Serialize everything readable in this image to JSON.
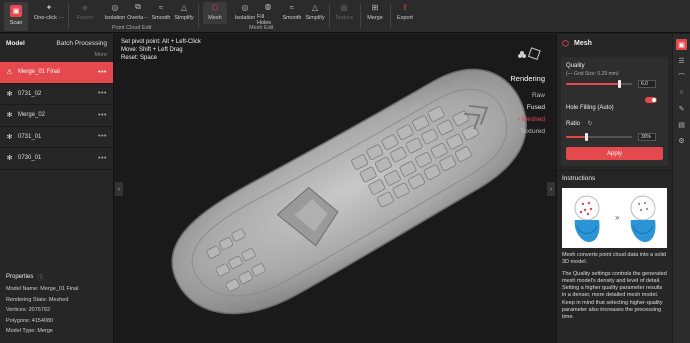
{
  "toolbar": {
    "scan": "Scan",
    "tools": [
      {
        "label": "One-click ···",
        "icon": "one-click-icon"
      },
      {
        "label": "Fusion",
        "icon": "fusion-icon"
      },
      {
        "label": "Isolation",
        "icon": "isolation-icon"
      },
      {
        "label": "Overla···",
        "icon": "overlap-icon"
      },
      {
        "label": "Smooth",
        "icon": "smooth-icon"
      },
      {
        "label": "Simplify",
        "icon": "simplify-icon"
      },
      {
        "label": "Mesh",
        "icon": "mesh-icon"
      },
      {
        "label": "Isolation",
        "icon": "isolation-icon"
      },
      {
        "label": "Fill Holes",
        "icon": "fill-holes-icon"
      },
      {
        "label": "Smooth",
        "icon": "smooth-icon"
      },
      {
        "label": "Simplify",
        "icon": "simplify-icon"
      },
      {
        "label": "Texture",
        "icon": "texture-icon"
      },
      {
        "label": "Merge",
        "icon": "merge-icon"
      },
      {
        "label": "Export",
        "icon": "export-icon"
      }
    ],
    "group_point_cloud": "Point Cloud Edit",
    "group_mesh": "Mesh Edit"
  },
  "left": {
    "title": "Model",
    "batch": "Batch Processing",
    "more": "More",
    "items": [
      {
        "label": "Merge_01 Final",
        "selected": true
      },
      {
        "label": "0731_02"
      },
      {
        "label": "Merge_02"
      },
      {
        "label": "0731_01"
      },
      {
        "label": "0730_01"
      }
    ],
    "properties_title": "Properties",
    "properties": [
      {
        "k": "Model Name:",
        "v": "Merge_01 Final"
      },
      {
        "k": "Rendering State:",
        "v": "Meshed"
      },
      {
        "k": "Vertices:",
        "v": "2076792"
      },
      {
        "k": "Polygons:",
        "v": "4154080"
      },
      {
        "k": "Model Type:",
        "v": "Merge"
      }
    ]
  },
  "viewport": {
    "hint1": "Set pivot point: Alt + Left-Click",
    "hint2": "Move: Shift + Left Drag",
    "hint3": "Reset: Space",
    "rendering_title": "Rendering",
    "modes": [
      "Raw",
      "Fused",
      "• Meshed",
      "Textured"
    ]
  },
  "mesh_panel": {
    "title": "Mesh",
    "quality_label": "Quality",
    "grid_size": "(— Grid Size: 0.29 mm)",
    "quality_value": "6.0",
    "quality_level": 0.8,
    "hole_filling_label": "Hole Filling (Auto)",
    "hole_filling_on": true,
    "ratio_label": "Ratio",
    "ratio_value": "30%",
    "ratio_level": 0.3,
    "apply": "Apply"
  },
  "instructions": {
    "title": "Instructions",
    "p1": "Mesh converts point cloud data into a solid 3D model.",
    "p2": "The Quality settings controls the generated mesh model's density and level of detail. Setting a higher quality parameter results in a denser, more detailed mesh model. Keep in mind that selecting higher-quality parameter also increases the processing time."
  },
  "colors": {
    "accent": "#e5484d",
    "bg": "#1e1e1e",
    "panel": "#262626"
  }
}
